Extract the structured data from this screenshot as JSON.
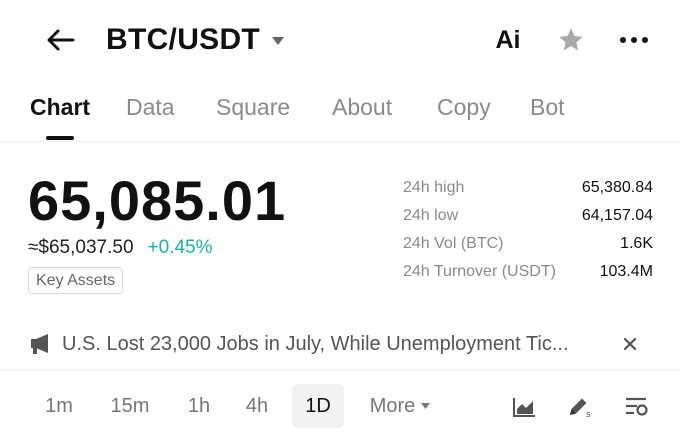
{
  "header": {
    "pair_title": "BTC/USDT",
    "ai_label": "Ai"
  },
  "tabs": [
    {
      "label": "Chart",
      "active": true
    },
    {
      "label": "Data",
      "active": false
    },
    {
      "label": "Square",
      "active": false
    },
    {
      "label": "About",
      "active": false
    },
    {
      "label": "Copy",
      "active": false
    },
    {
      "label": "Bot",
      "active": false
    }
  ],
  "ticker": {
    "price": "65,085.01",
    "usd_equivalent": "≈$65,037.50",
    "change": "+0.45%",
    "badge": "Key Assets"
  },
  "stats": [
    {
      "label": "24h high",
      "value": "65,380.84"
    },
    {
      "label": "24h low",
      "value": "64,157.04"
    },
    {
      "label": "24h Vol (BTC)",
      "value": "1.6K"
    },
    {
      "label": "24h Turnover (USDT)",
      "value": "103.4M"
    }
  ],
  "news": {
    "headline": "U.S. Lost 23,000 Jobs in July, While Unemployment Tic..."
  },
  "timeframes": [
    {
      "label": "1m",
      "active": false
    },
    {
      "label": "15m",
      "active": false
    },
    {
      "label": "1h",
      "active": false
    },
    {
      "label": "4h",
      "active": false
    },
    {
      "label": "1D",
      "active": true
    }
  ],
  "more_label": "More",
  "colors": {
    "accent_positive": "#16b4a2",
    "text_primary": "#111111",
    "text_secondary": "#8a8a8a"
  },
  "icons": {
    "back": "arrow-left-icon",
    "caret": "caret-down-icon",
    "star": "star-icon",
    "more": "ellipsis-icon",
    "news": "megaphone-icon",
    "close": "close-icon",
    "chart_type": "area-chart-icon",
    "draw": "pencil-icon",
    "settings": "sliders-icon"
  }
}
